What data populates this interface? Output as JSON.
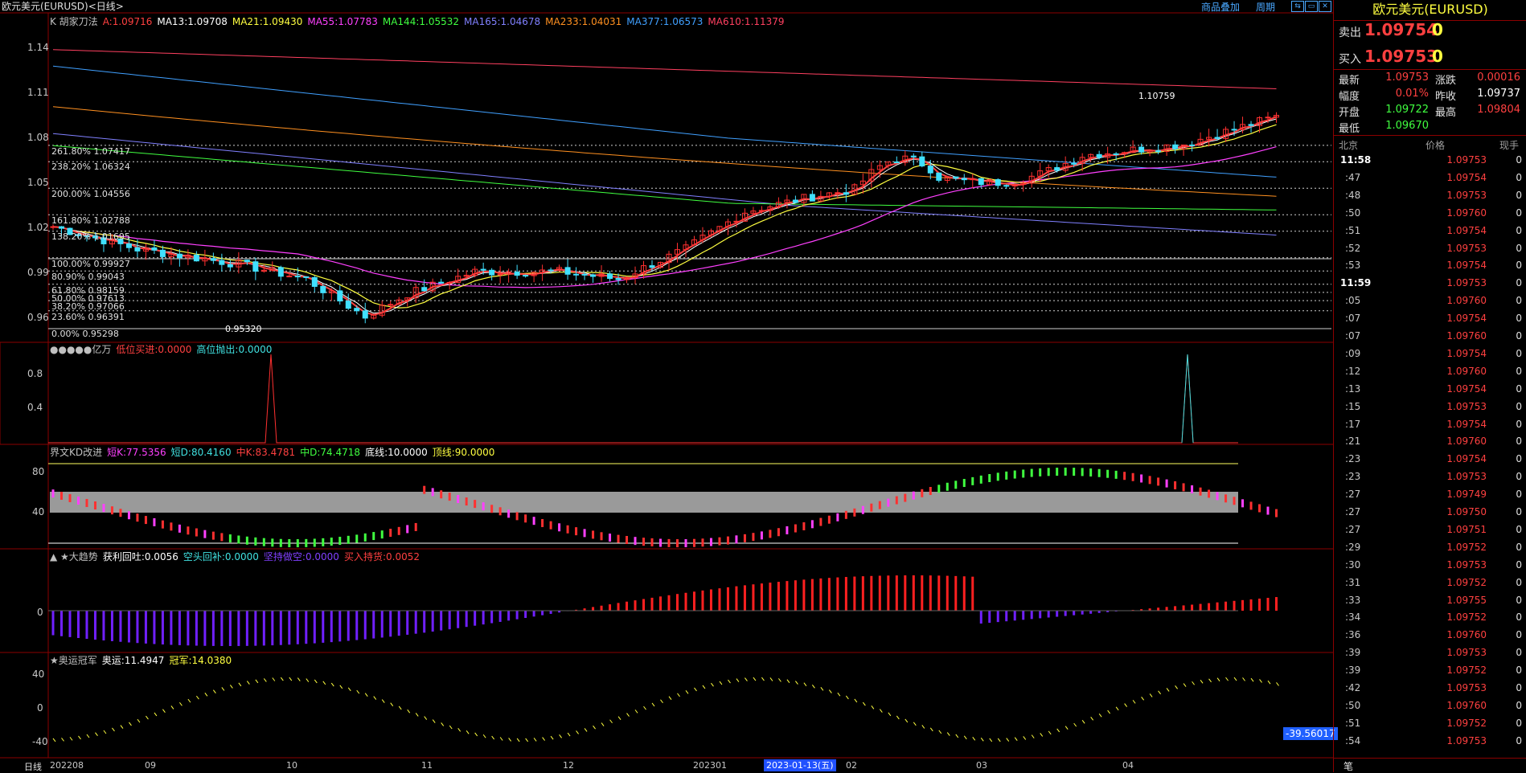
{
  "window": {
    "title": "欧元美元(EURUSD)<日线>"
  },
  "top_links": {
    "overlay": "商品叠加",
    "period": "周期"
  },
  "main_panel": {
    "indicator_line": [
      {
        "text": "K  胡家刀法",
        "color": "#c0c0c0"
      },
      {
        "text": "A:1.09716",
        "color": "#ff4040"
      },
      {
        "text": "MA13:1.09708",
        "color": "#ffffff"
      },
      {
        "text": "MA21:1.09430",
        "color": "#ffff40"
      },
      {
        "text": "MA55:1.07783",
        "color": "#ff40ff"
      },
      {
        "text": "MA144:1.05532",
        "color": "#40ff40"
      },
      {
        "text": "MA165:1.04678",
        "color": "#8080ff"
      },
      {
        "text": "MA233:1.04031",
        "color": "#ff9020"
      },
      {
        "text": "MA377:1.06573",
        "color": "#40a0ff"
      },
      {
        "text": "MA610:1.11379",
        "color": "#ff4060"
      }
    ],
    "y_ticks": [
      "1.14",
      "1.11",
      "1.08",
      "1.05",
      "1.02",
      "0.99",
      "0.96"
    ],
    "fib_levels": [
      "261.80% 1.07417",
      "238.20% 1.06324",
      "200.00% 1.04556",
      "161.80% 1.02788",
      "138.20% 1.01695",
      "100.00% 0.99927",
      "80.90% 0.99043",
      "61.80% 0.98159",
      "50.00% 0.97613",
      "38.20% 0.97066",
      "23.60% 0.96391",
      "0.00% 0.95298"
    ],
    "high_label": "1.10759",
    "low_label": "0.95320"
  },
  "panel2": {
    "line": [
      {
        "text": "●●●●●亿万",
        "color": "#c0c0c0"
      },
      {
        "text": "低位买进:0.0000",
        "color": "#ff4040"
      },
      {
        "text": "高位抛出:0.0000",
        "color": "#40e0e0"
      }
    ],
    "y_ticks": [
      "0.8",
      "0.4"
    ]
  },
  "panel3": {
    "line": [
      {
        "text": "界文KD改进",
        "color": "#c0c0c0"
      },
      {
        "text": "短K:77.5356",
        "color": "#ff40ff"
      },
      {
        "text": "短D:80.4160",
        "color": "#40e0e0"
      },
      {
        "text": "中K:83.4781",
        "color": "#ff4040"
      },
      {
        "text": "中D:74.4718",
        "color": "#40ff40"
      },
      {
        "text": "底线:10.0000",
        "color": "#ffffff"
      },
      {
        "text": "顶线:90.0000",
        "color": "#ffff40"
      }
    ],
    "y_ticks": [
      "80",
      "40"
    ]
  },
  "panel4": {
    "line": [
      {
        "text": "▲ ★大趋势",
        "color": "#c0c0c0"
      },
      {
        "text": "获利回吐:0.0056",
        "color": "#ffffff"
      },
      {
        "text": "空头回补:0.0000",
        "color": "#40e0e0"
      },
      {
        "text": "坚持做空:0.0000",
        "color": "#8040ff"
      },
      {
        "text": "买入持货:0.0052",
        "color": "#ff4040"
      }
    ],
    "y_ticks": [
      "0"
    ]
  },
  "panel5": {
    "line": [
      {
        "text": "★奥运冠军",
        "color": "#c0c0c0"
      },
      {
        "text": "奥运:11.4947",
        "color": "#ffffff"
      },
      {
        "text": "冠军:14.0380",
        "color": "#ffff40"
      }
    ],
    "y_ticks": [
      "40",
      "0",
      "-40"
    ],
    "cursor_value": "-39.56017"
  },
  "x_axis": {
    "period_label": "日线",
    "labels": [
      "202208",
      "09",
      "10",
      "11",
      "12",
      "202301",
      "02",
      "03",
      "04"
    ],
    "cursor_date": "2023-01-13(五)"
  },
  "quote": {
    "title": "欧元美元(EURUSD)",
    "sell_label": "卖出",
    "sell_price": "1.09754",
    "sell_vol": "0",
    "buy_label": "买入",
    "buy_price": "1.09753",
    "buy_vol": "0",
    "latest_label": "最新",
    "latest": "1.09753",
    "change_label": "涨跌",
    "change": "0.00016",
    "range_label": "幅度",
    "range": "0.01%",
    "prev_label": "昨收",
    "prev": "1.09737",
    "open_label": "开盘",
    "open": "1.09722",
    "high_label": "最高",
    "high": "1.09804",
    "low_label": "最低",
    "low": "1.09670",
    "col_time": "北京",
    "col_price": "价格",
    "col_vol": "现手",
    "bottom_label": "笔"
  },
  "ticks": [
    {
      "t": "11:58",
      "p": "1.09753",
      "v": "0"
    },
    {
      "t": ":47",
      "p": "1.09754",
      "v": "0"
    },
    {
      "t": ":48",
      "p": "1.09753",
      "v": "0"
    },
    {
      "t": ":50",
      "p": "1.09760",
      "v": "0"
    },
    {
      "t": ":51",
      "p": "1.09754",
      "v": "0"
    },
    {
      "t": ":52",
      "p": "1.09753",
      "v": "0"
    },
    {
      "t": ":53",
      "p": "1.09754",
      "v": "0"
    },
    {
      "t": "11:59",
      "p": "1.09753",
      "v": "0"
    },
    {
      "t": ":05",
      "p": "1.09760",
      "v": "0"
    },
    {
      "t": ":07",
      "p": "1.09754",
      "v": "0"
    },
    {
      "t": ":07",
      "p": "1.09760",
      "v": "0"
    },
    {
      "t": ":09",
      "p": "1.09754",
      "v": "0"
    },
    {
      "t": ":12",
      "p": "1.09760",
      "v": "0"
    },
    {
      "t": ":13",
      "p": "1.09754",
      "v": "0"
    },
    {
      "t": ":15",
      "p": "1.09753",
      "v": "0"
    },
    {
      "t": ":17",
      "p": "1.09754",
      "v": "0"
    },
    {
      "t": ":21",
      "p": "1.09760",
      "v": "0"
    },
    {
      "t": ":23",
      "p": "1.09754",
      "v": "0"
    },
    {
      "t": ":23",
      "p": "1.09753",
      "v": "0"
    },
    {
      "t": ":27",
      "p": "1.09749",
      "v": "0"
    },
    {
      "t": ":27",
      "p": "1.09750",
      "v": "0"
    },
    {
      "t": ":27",
      "p": "1.09751",
      "v": "0"
    },
    {
      "t": ":29",
      "p": "1.09752",
      "v": "0"
    },
    {
      "t": ":30",
      "p": "1.09753",
      "v": "0"
    },
    {
      "t": ":31",
      "p": "1.09752",
      "v": "0"
    },
    {
      "t": ":33",
      "p": "1.09755",
      "v": "0"
    },
    {
      "t": ":34",
      "p": "1.09752",
      "v": "0"
    },
    {
      "t": ":36",
      "p": "1.09760",
      "v": "0"
    },
    {
      "t": ":39",
      "p": "1.09753",
      "v": "0"
    },
    {
      "t": ":39",
      "p": "1.09752",
      "v": "0"
    },
    {
      "t": ":42",
      "p": "1.09753",
      "v": "0"
    },
    {
      "t": ":50",
      "p": "1.09760",
      "v": "0"
    },
    {
      "t": ":51",
      "p": "1.09752",
      "v": "0"
    },
    {
      "t": ":54",
      "p": "1.09753",
      "v": "0"
    }
  ]
}
